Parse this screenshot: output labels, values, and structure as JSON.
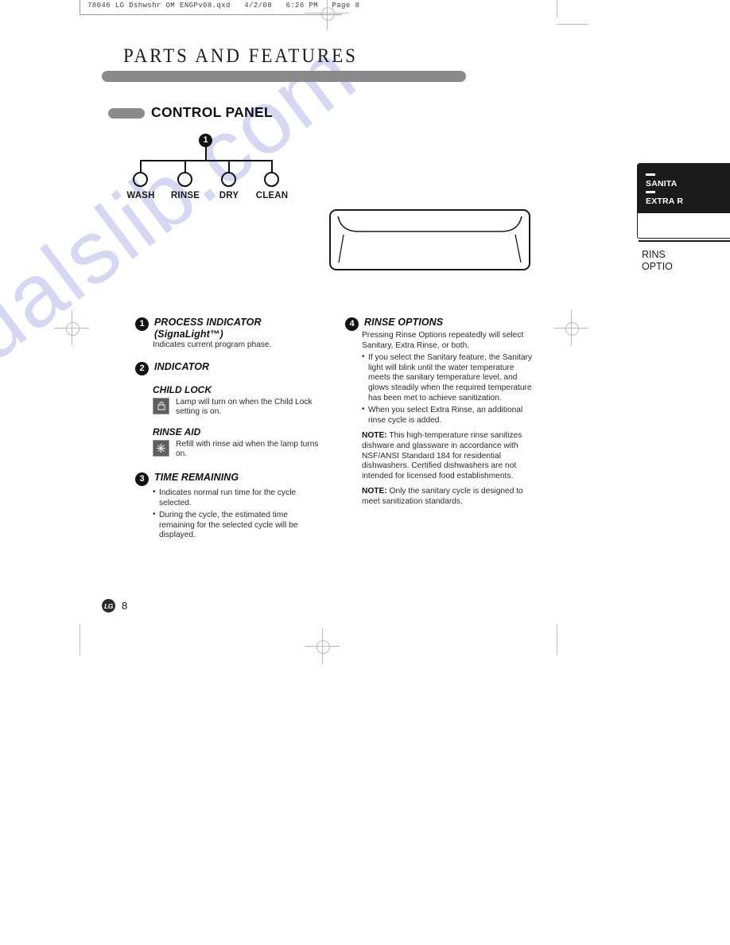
{
  "print_slug": "78046 LG Dshwshr OM ENGPv08.qxd   4/2/08   6:26 PM   Page 8",
  "watermark": "manualslib.com",
  "header": {
    "page_title": "PARTS AND FEATURES",
    "section_title": "CONTROL PANEL"
  },
  "diagram": {
    "callout": "1",
    "labels": [
      "WASH",
      "RINSE",
      "DRY",
      "CLEAN"
    ]
  },
  "panel_detail": {
    "option_sanitary": "SANITA",
    "option_extra_rinse": "EXTRA R",
    "caption_line1": "RINS",
    "caption_line2": "OPTIO"
  },
  "left_column": {
    "item1": {
      "callout": "1",
      "title": "PROCESS INDICATOR (SignaLight™)",
      "text": "Indicates current program phase."
    },
    "item2": {
      "callout": "2",
      "title": "INDICATOR",
      "child_lock": {
        "heading": "CHILD LOCK",
        "icon": "padlock-icon",
        "text": "Lamp will turn on when the Child Lock setting is on."
      },
      "rinse_aid": {
        "heading": "RINSE AID",
        "icon": "starburst-icon",
        "text": "Refill with rinse aid when the lamp turns on."
      }
    },
    "item3": {
      "callout": "3",
      "title": "TIME REMAINING",
      "bullets": [
        "Indicates normal run time for the cycle selected.",
        "During the cycle, the estimated time remaining for the selected cycle will be displayed."
      ]
    }
  },
  "right_column": {
    "item4": {
      "callout": "4",
      "title": "RINSE OPTIONS",
      "text": "Pressing Rinse Options repeatedly will select Sanitary, Extra Rinse, or both.",
      "bullets": [
        "If you select the Sanitary feature, the Sanitary light will blink until the water temperature meets the sanitary temperature level, and glows steadily when the required temperature has been met to achieve sanitization.",
        "When you select Extra Rinse, an additional rinse cycle is added."
      ],
      "note1_label": "NOTE:",
      "note1_text": " This high-temperature rinse sanitizes dishware and glassware in accordance with NSF/ANSI Standard 184 for residential dishwashers. Certified dishwashers are not intended for licensed food establishments.",
      "note2_label": "NOTE:",
      "note2_text": " Only the sanitary cycle is designed to meet sanitization standards."
    }
  },
  "footer": {
    "brand": "LG",
    "page_number": "8"
  }
}
